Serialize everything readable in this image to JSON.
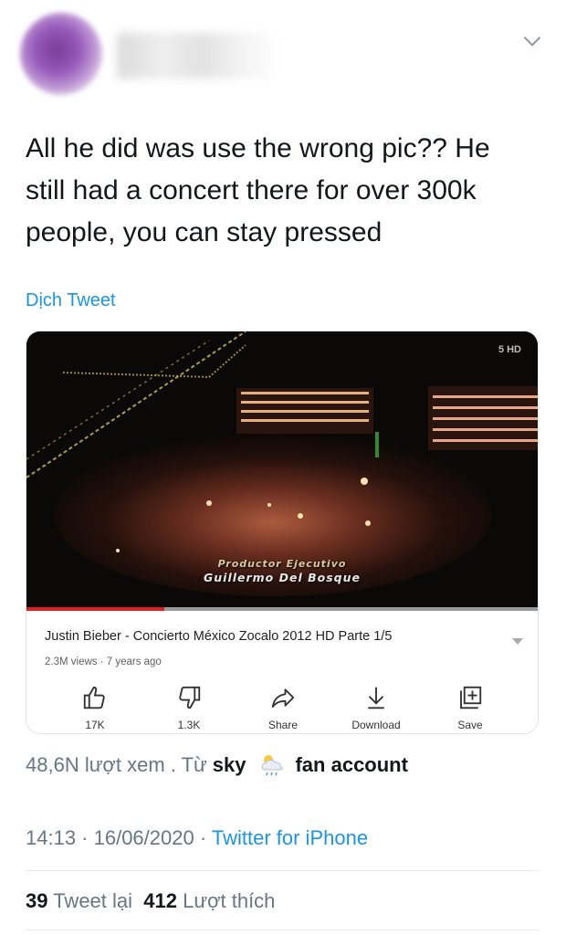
{
  "tweet": {
    "text": "All he did was use the wrong pic?? He\nstill had a concert there for over 300k\npeople, you can stay pressed",
    "translate_label": "Dịch Tweet"
  },
  "video_card": {
    "overlay_line1": "Productor Ejecutivo",
    "overlay_line2": "Guillermo Del Bosque",
    "channel_logo": "5 HD",
    "progress_fraction": 0.27,
    "title": "Justin Bieber - Concierto México Zocalo 2012 HD Parte 1/5",
    "meta": "2.3M views · 7 years ago",
    "actions": [
      {
        "icon": "thumbs-up-icon",
        "label": "17K"
      },
      {
        "icon": "thumbs-down-icon",
        "label": "1.3K"
      },
      {
        "icon": "share-icon",
        "label": "Share"
      },
      {
        "icon": "download-icon",
        "label": "Download"
      },
      {
        "icon": "save-icon",
        "label": "Save"
      }
    ]
  },
  "views_line": {
    "count_text": "48,6N lượt xem . Từ",
    "user": "sky",
    "suffix": "fan account"
  },
  "timestamp": {
    "time": "14:13 · 16/06/2020 ·",
    "source": "Twitter for iPhone"
  },
  "stats": {
    "retweets": "39",
    "retweets_label": "Tweet lại",
    "likes": "412",
    "likes_label": "Lượt thích"
  },
  "colors": {
    "link": "#1b95e0",
    "secondary_text": "#657786",
    "progress_red": "#e02020"
  }
}
